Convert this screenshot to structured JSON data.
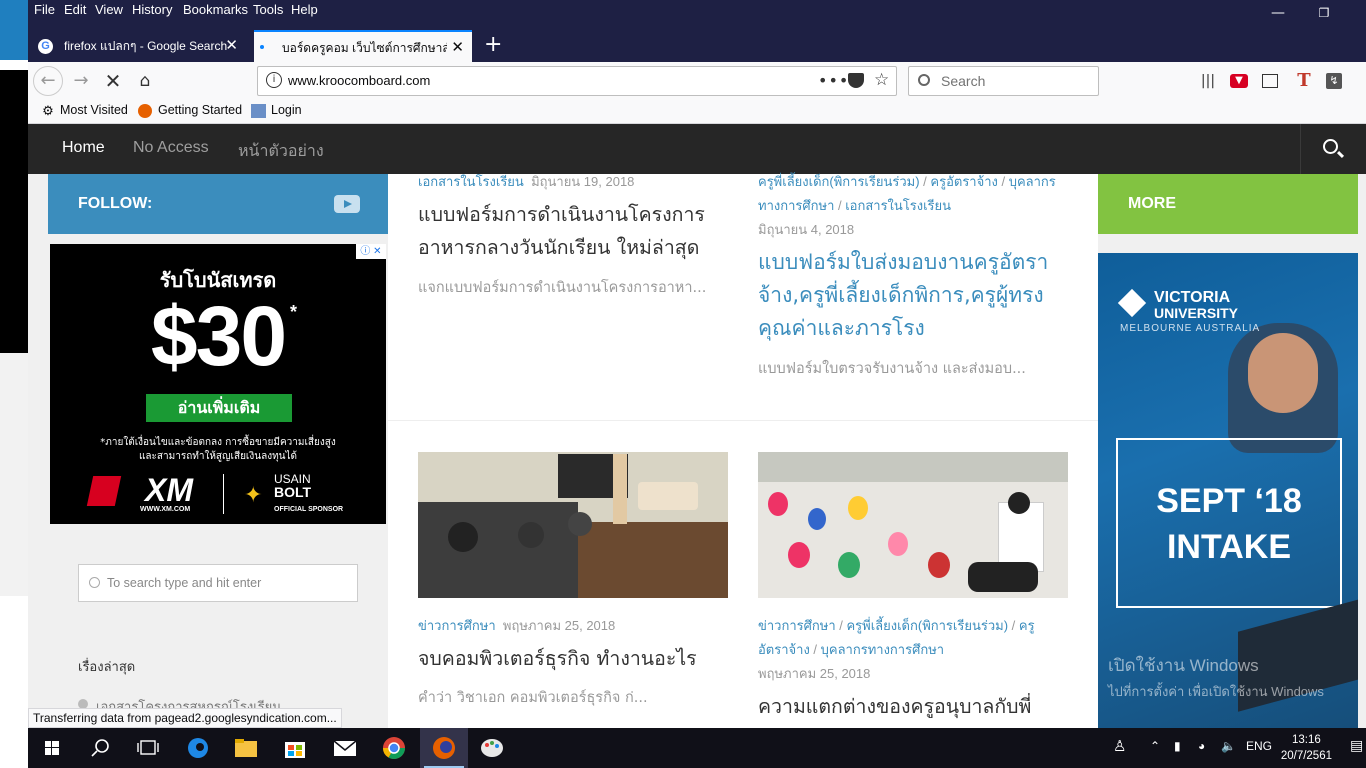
{
  "menu": {
    "file": "File",
    "edit": "Edit",
    "view": "View",
    "history": "History",
    "bookmarks": "Bookmarks",
    "tools": "Tools",
    "help": "Help"
  },
  "tabs": [
    {
      "label": "firefox แปลกๆ - Google Search"
    },
    {
      "label": "บอร์ดครูคอม เว็บไซต์การศึกษาสำหรั"
    }
  ],
  "address": {
    "url": "www.kroocomboard.com"
  },
  "search": {
    "placeholder": "Search"
  },
  "bookmarks": [
    {
      "label": "Most Visited"
    },
    {
      "label": "Getting Started"
    },
    {
      "label": "Login"
    }
  ],
  "site_nav": {
    "items": [
      {
        "label": "Home"
      },
      {
        "label": "No Access"
      },
      {
        "label": "หน้าตัวอย่าง"
      }
    ]
  },
  "sidebar": {
    "follow": "FOLLOW:",
    "search_placeholder": "To search type and hit enter",
    "recent_heading": "เรื่องล่าสุด",
    "recent_item": "เอกสารโครงการสหกรณ์โรงเรียน"
  },
  "ad_xm": {
    "headline": "รับโบนัสเทรด",
    "amount": "$30",
    "star": "*",
    "cta": "อ่านเพิ่มเติม",
    "disclaimer_1": "*ภายใต้เงื่อนไขและข้อตกลง การซื้อขายมีความเสี่ยงสูง",
    "disclaimer_2": "และสามารถทำให้สูญเสียเงินลงทุนได้",
    "brand": "XM",
    "brand_url": "WWW.XM.COM",
    "sponsor_1": "USAIN",
    "sponsor_2": "BOLT",
    "sponsor_3": "OFFICIAL SPONSOR"
  },
  "posts": [
    {
      "categories": [
        "เอกสารในโรงเรียน"
      ],
      "date": "มิถุนายน 19, 2018",
      "title": "แบบฟอร์มการดำเนินงานโครงการอาหารกลางวันนักเรียน ใหม่ล่าสุด",
      "excerpt": "แจกแบบฟอร์มการดำเนินงานโครงการอาหา..."
    },
    {
      "categories": [
        "ครูพี่เลี้ยงเด็ก(พิการเรียนร่วม)",
        "ครูอัตราจ้าง",
        "บุคลากรทางการศึกษา",
        "เอกสารในโรงเรียน"
      ],
      "date": "มิถุนายน 4, 2018",
      "title": "แบบฟอร์มใบส่งมอบงานครูอัตราจ้าง,ครูพี่เลี้ยงเด็กพิการ,ครูผู้ทรงคุณค่าและภารโรง",
      "excerpt": "แบบฟอร์มใบตรวจรับงานจ้าง และส่งมอบ..."
    },
    {
      "categories": [
        "ข่าวการศึกษา"
      ],
      "date": "พฤษภาคม 25, 2018",
      "title": "จบคอมพิวเตอร์ธุรกิจ ทำงานอะไร",
      "excerpt": "คำว่า วิชาเอก คอมพิวเตอร์ธุรกิจ ก่..."
    },
    {
      "categories": [
        "ข่าวการศึกษา",
        "ครูพี่เลี้ยงเด็ก(พิการเรียนร่วม)",
        "ครูอัตราจ้าง",
        "บุคลากรทางการศึกษา"
      ],
      "date": "พฤษภาคม 25, 2018",
      "title": "ความแตกต่างของครูอนุบาลกับพี่"
    }
  ],
  "right": {
    "more": "MORE"
  },
  "ad_vu": {
    "brand_1": "VICTORIA",
    "brand_2": "UNIVERSITY",
    "brand_3": "MELBOURNE AUSTRALIA",
    "line1": "SEPT ‘18",
    "line2": "INTAKE"
  },
  "status": {
    "text": "Transferring data from pagead2.googlesyndication.com..."
  },
  "watermark": {
    "line1": "เปิดใช้งาน Windows",
    "line2": "ไปที่การตั้งค่า เพื่อเปิดใช้งาน Windows"
  },
  "tray": {
    "lang": "ENG",
    "time": "13:16",
    "date": "20/7/2561"
  }
}
